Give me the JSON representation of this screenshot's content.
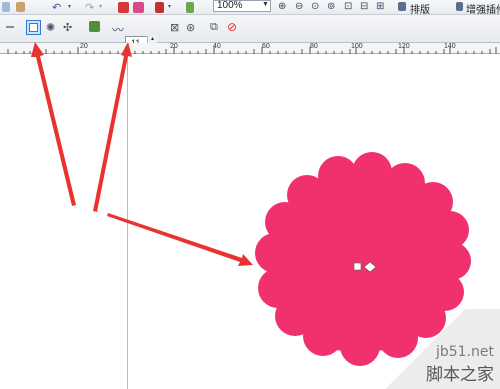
{
  "toolbar_top": {
    "zoom_value": "100%",
    "layout_label": "排版",
    "enhance_label": "增强插件"
  },
  "property_bar": {
    "nudge_value": "-11"
  },
  "ruler": {
    "ticks": [
      "20",
      "20",
      "40",
      "60",
      "80",
      "100",
      "120",
      "140"
    ]
  },
  "watermark": {
    "url": "jb51.net",
    "site_name": "脚本之家"
  },
  "colors": {
    "flower_fill": "#f0316e",
    "arrow": "#e8332f",
    "selected_button": "#2e7bd6"
  }
}
